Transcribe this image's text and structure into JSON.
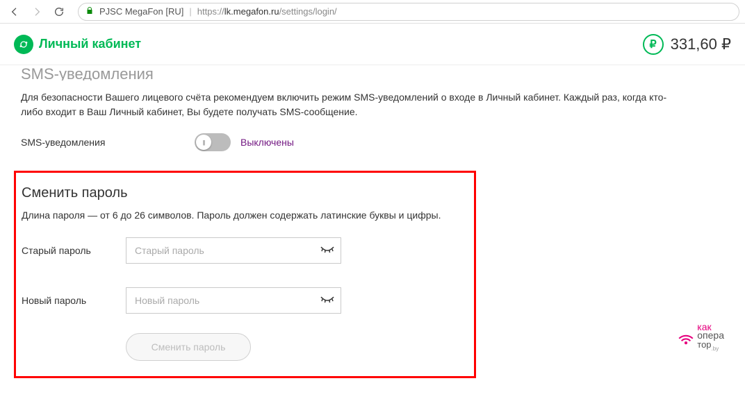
{
  "browser": {
    "origin_label": "PJSC MegaFon [RU]",
    "url_prefix": "https://",
    "url_host": "lk.megafon.ru",
    "url_path": "/settings/login/"
  },
  "header": {
    "brand": "Личный кабинет",
    "balance_symbol": "₽",
    "balance_value": "331,60 ₽"
  },
  "sms": {
    "title": "SMS-уведомления",
    "desc": "Для безопасности Вашего лицевого счёта рекомендуем включить режим SMS-уведомлений о входе в Личный кабинет. Каждый раз, когда кто-либо входит в Ваш Личный кабинет, Вы будете получать SMS-сообщение.",
    "row_label": "SMS-уведомления",
    "status": "Выключены"
  },
  "password": {
    "title": "Сменить пароль",
    "desc": "Длина пароля — от 6 до 26 символов. Пароль должен содержать латинские буквы и цифры.",
    "old_label": "Старый пароль",
    "old_placeholder": "Старый пароль",
    "new_label": "Новый пароль",
    "new_placeholder": "Новый пароль",
    "submit": "Сменить пароль"
  },
  "watermark": {
    "line1": "как",
    "line2": "опера",
    "line3": "тор",
    "sub": ".by"
  }
}
